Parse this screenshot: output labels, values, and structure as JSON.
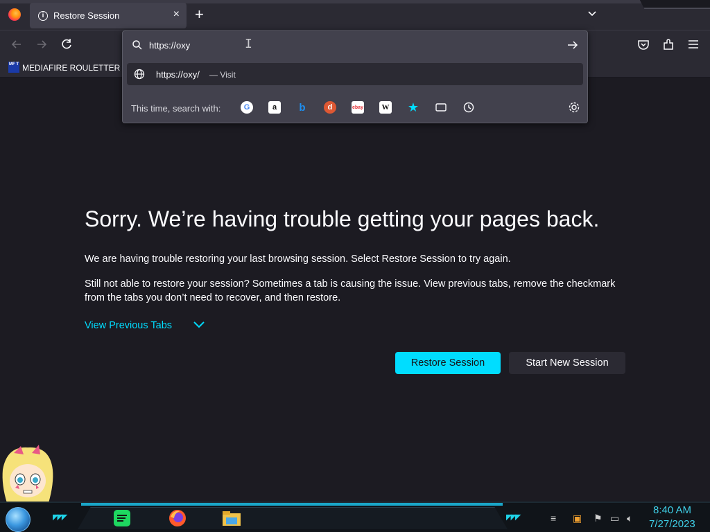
{
  "tab": {
    "title": "Restore Session",
    "close": "×"
  },
  "tabbar": {
    "new_tab": "+"
  },
  "bookmarks": {
    "item1_icon_text": "MF T",
    "item1_label": "MEDIAFIRE ROULETTER"
  },
  "urlbar": {
    "value": "https://oxy",
    "suggestion_url": "https://oxy/",
    "suggestion_action": "— Visit",
    "search_with_label": "This time, search with:",
    "engines": [
      "google-icon",
      "amazon-icon",
      "bing-icon",
      "duckduckgo-icon",
      "ebay-icon",
      "wikipedia-icon",
      "bookmarks-star-icon",
      "tabs-icon",
      "history-icon"
    ]
  },
  "main": {
    "title": "Sorry. We’re having trouble getting your pages back.",
    "para1": "We are having trouble restoring your last browsing session. Select Restore Session to try again.",
    "para2": "Still not able to restore your session? Sometimes a tab is causing the issue. View previous tabs, remove the checkmark from the tabs you don’t need to recover, and then restore.",
    "view_previous": "View Previous Tabs",
    "restore_button": "Restore Session",
    "new_session_button": "Start New Session"
  },
  "taskbar": {
    "time": "8:40 AM",
    "date": "7/27/2023"
  },
  "colors": {
    "accent": "#00ddff",
    "bg": "#1c1b22",
    "toolbar": "#2b2a33",
    "panel": "#42414d",
    "clock": "#3fd0e8"
  }
}
